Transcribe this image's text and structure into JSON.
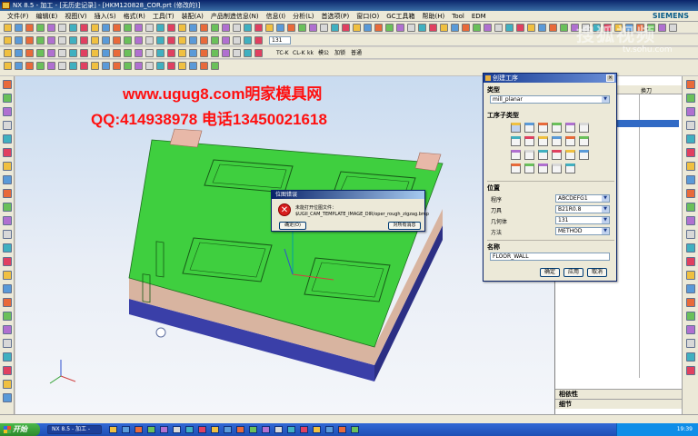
{
  "window": {
    "title": "NX 8.5 - 加工 - [无历史记录] - [HKM120828_COR.prt (修改的)]"
  },
  "brand": "SIEMENS",
  "menu": [
    "文件(F)",
    "编辑(E)",
    "视图(V)",
    "插入(S)",
    "格式(R)",
    "工具(T)",
    "装配(A)",
    "产品制造信息(N)",
    "信息(I)",
    "分析(L)",
    "首选项(P)",
    "窗口(O)",
    "GC工具箱",
    "帮助(H)",
    "Tool",
    "EDM"
  ],
  "toolbar": {
    "number_field": "131",
    "text_items": [
      "TC-K",
      "CL-K",
      "kk",
      "模公",
      "加锁",
      "普通"
    ]
  },
  "watermark": {
    "line1": "www.ugug8.com明家模具网",
    "line2": "QQ:414938978 电话13450021618",
    "sohu_logo": "搜狐视频",
    "sohu_url": "tv.sohu.com"
  },
  "navigator": {
    "col2": "换刀",
    "bottom1": "相依性",
    "bottom2": "细节"
  },
  "create_dialog": {
    "title": "创建工序",
    "type_header": "类型",
    "type_value": "mill_planar",
    "subtype_header": "工序子类型",
    "location_header": "位置",
    "program_label": "程序",
    "program_value": "ABCDEFG1",
    "tool_label": "刀具",
    "tool_value": "B21R0.8",
    "geometry_label": "几何体",
    "geometry_value": "131",
    "method_label": "方法",
    "method_value": "METHOD",
    "name_header": "名称",
    "name_value": "FLOOR_WALL",
    "ok": "确定",
    "apply": "应用",
    "cancel": "取消"
  },
  "error_dialog": {
    "title": "位图错误",
    "message_line1": "未能打开位图文件：",
    "message_line2": "$UGII_CAM_TEMPLATE_IMAGE_DIR/oper_rough_zigzag.bmp",
    "ok": "确定(O)",
    "cancel_all": "对所有消息"
  },
  "taskbar": {
    "start": "开始",
    "task": "NX 8.5 - 加工 -",
    "clock": "19:39"
  },
  "colors": {
    "plate_green": "#3fcf3f",
    "base_blue": "#3a3fa8",
    "watermark_red": "#ff1010"
  }
}
